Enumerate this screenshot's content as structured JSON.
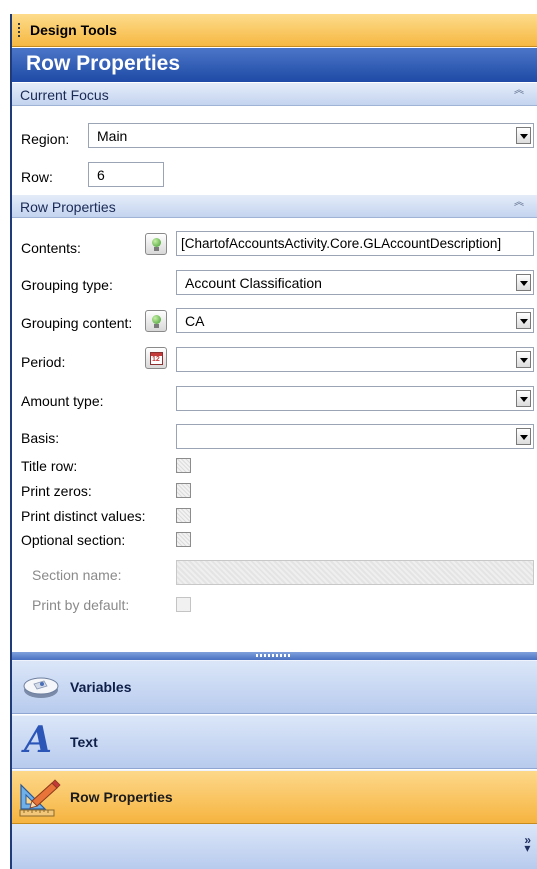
{
  "header": {
    "design_tools_title": "Design Tools",
    "main_title": "Row Properties"
  },
  "current_focus": {
    "section_title": "Current Focus",
    "region_label": "Region:",
    "region_value": "Main",
    "row_label": "Row:",
    "row_value": "6"
  },
  "row_properties": {
    "section_title": "Row Properties",
    "contents_label": "Contents:",
    "contents_value": "[ChartofAccountsActivity.Core.GLAccountDescription]",
    "grouping_type_label": "Grouping type:",
    "grouping_type_value": "Account Classification",
    "grouping_content_label": "Grouping content:",
    "grouping_content_value": "CA",
    "period_label": "Period:",
    "period_value": "",
    "period_icon_text": "12",
    "amount_type_label": "Amount type:",
    "amount_type_value": "",
    "basis_label": "Basis:",
    "basis_value": "",
    "title_row_label": "Title row:",
    "title_row_checked": false,
    "print_zeros_label": "Print zeros:",
    "print_zeros_checked": false,
    "print_distinct_label": "Print distinct values:",
    "print_distinct_checked": false,
    "optional_section_label": "Optional section:",
    "optional_section_checked": false,
    "section_name_label": "Section name:",
    "section_name_value": "",
    "print_by_default_label": "Print by default:",
    "print_by_default_checked": false
  },
  "navigation": {
    "items": [
      {
        "label": "Variables",
        "icon": "keyboard-key-icon",
        "active": false
      },
      {
        "label": "Text",
        "icon": "letter-a-icon",
        "active": false
      },
      {
        "label": "Row Properties",
        "icon": "pencil-ruler-icon",
        "active": true
      }
    ],
    "more_icon": "chevron-double-down-icon"
  },
  "colors": {
    "accent_orange": "#f6b842",
    "title_blue": "#1f4aa6",
    "section_blue": "#c4d4ef"
  }
}
